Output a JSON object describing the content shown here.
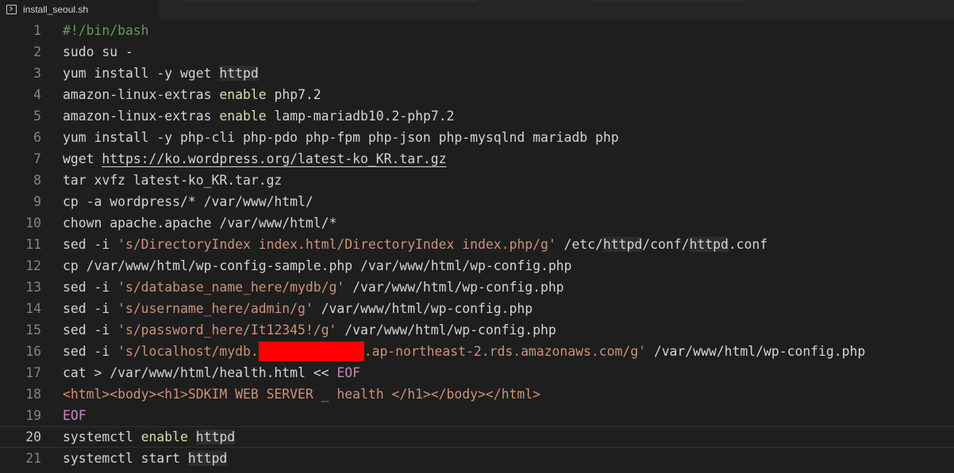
{
  "tab": {
    "title": "install_seoul.sh",
    "icon": "terminal-file-icon"
  },
  "colors": {
    "background": "#1e1e1e",
    "comment": "#6a9955",
    "keyword": "#dcdcaa",
    "string": "#ce9178",
    "eof": "#c586c0",
    "redaction": "#ff0000"
  },
  "editor": {
    "current_line": 20,
    "lines": [
      {
        "n": "1",
        "parts": [
          {
            "t": "#!/bin/bash",
            "c": "com"
          }
        ]
      },
      {
        "n": "2",
        "parts": [
          {
            "t": "sudo su -"
          }
        ]
      },
      {
        "n": "3",
        "parts": [
          {
            "t": "yum install -y wget "
          },
          {
            "t": "httpd",
            "c": "hl"
          }
        ]
      },
      {
        "n": "4",
        "parts": [
          {
            "t": "amazon-linux-extras "
          },
          {
            "t": "enable",
            "c": "kw"
          },
          {
            "t": " php7.2"
          }
        ]
      },
      {
        "n": "5",
        "parts": [
          {
            "t": "amazon-linux-extras "
          },
          {
            "t": "enable",
            "c": "kw"
          },
          {
            "t": " lamp-mariadb10.2-php7.2"
          }
        ]
      },
      {
        "n": "6",
        "parts": [
          {
            "t": "yum install -y php-cli php-pdo php-fpm php-json php-mysqlnd mariadb php"
          }
        ]
      },
      {
        "n": "7",
        "parts": [
          {
            "t": "wget "
          },
          {
            "t": "https://ko.wordpress.org/latest-ko_KR.tar.gz",
            "c": "url"
          }
        ]
      },
      {
        "n": "8",
        "parts": [
          {
            "t": "tar xvfz latest-ko_KR.tar.gz"
          }
        ]
      },
      {
        "n": "9",
        "parts": [
          {
            "t": "cp -a wordpress/* /var/www/html/"
          }
        ]
      },
      {
        "n": "10",
        "parts": [
          {
            "t": "chown apache.apache /var/www/html/*"
          }
        ]
      },
      {
        "n": "11",
        "parts": [
          {
            "t": "sed -i "
          },
          {
            "t": "'s/DirectoryIndex index.html/DirectoryIndex index.php/g'",
            "c": "str"
          },
          {
            "t": " /etc/"
          },
          {
            "t": "httpd",
            "c": "hl"
          },
          {
            "t": "/conf/"
          },
          {
            "t": "httpd",
            "c": "hl"
          },
          {
            "t": ".conf"
          }
        ]
      },
      {
        "n": "12",
        "parts": [
          {
            "t": "cp /var/www/html/wp-config-sample.php /var/www/html/wp-config.php"
          }
        ]
      },
      {
        "n": "13",
        "parts": [
          {
            "t": "sed -i "
          },
          {
            "t": "'s/database_name_here/mydb/g'",
            "c": "str"
          },
          {
            "t": " /var/www/html/wp-config.php"
          }
        ]
      },
      {
        "n": "14",
        "parts": [
          {
            "t": "sed -i "
          },
          {
            "t": "'s/username_here/admin/g'",
            "c": "str"
          },
          {
            "t": " /var/www/html/wp-config.php"
          }
        ]
      },
      {
        "n": "15",
        "parts": [
          {
            "t": "sed -i "
          },
          {
            "t": "'s/password_here/It12345!/g'",
            "c": "str"
          },
          {
            "t": " /var/www/html/wp-config.php"
          }
        ]
      },
      {
        "n": "16",
        "parts": [
          {
            "t": "sed -i "
          },
          {
            "t": "'s/localhost/mydb.",
            "c": "str"
          },
          {
            "t": "",
            "c": "redact"
          },
          {
            "t": ".ap-northeast-2.rds.amazonaws.com/g'",
            "c": "str"
          },
          {
            "t": " /var/www/html/wp-config.php"
          }
        ]
      },
      {
        "n": "17",
        "parts": [
          {
            "t": "cat > /var/www/html/health.html << "
          },
          {
            "t": "EOF",
            "c": "eof"
          }
        ]
      },
      {
        "n": "18",
        "parts": [
          {
            "t": "<html><body><h1>SDKIM WEB SERVER _ health </h1></body></html>",
            "c": "str"
          }
        ]
      },
      {
        "n": "19",
        "parts": [
          {
            "t": "EOF",
            "c": "eof"
          }
        ]
      },
      {
        "n": "20",
        "parts": [
          {
            "t": "systemctl "
          },
          {
            "t": "enable",
            "c": "kw"
          },
          {
            "t": " "
          },
          {
            "t": "httpd",
            "c": "hl"
          }
        ]
      },
      {
        "n": "21",
        "parts": [
          {
            "t": "systemctl start "
          },
          {
            "t": "httpd",
            "c": "hl"
          }
        ]
      }
    ]
  }
}
